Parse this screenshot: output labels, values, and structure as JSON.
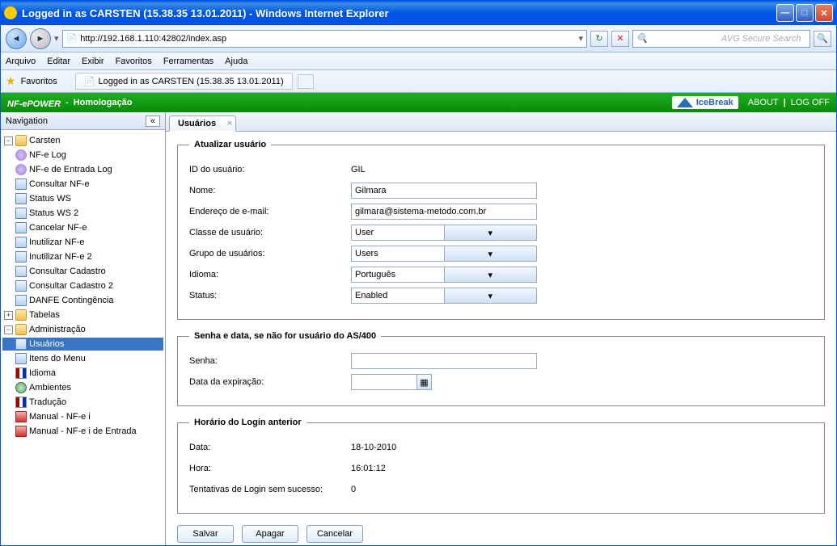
{
  "window": {
    "title": "Logged in as CARSTEN (15.38.35 13.01.2011) - Windows Internet Explorer"
  },
  "browser": {
    "url": "http://192.168.1.110:42802/index.asp",
    "search_placeholder": "AVG Secure Search",
    "menu": {
      "arquivo": "Arquivo",
      "editar": "Editar",
      "exibir": "Exibir",
      "favoritos": "Favoritos",
      "ferramentas": "Ferramentas",
      "ajuda": "Ajuda"
    },
    "fav_label": "Favoritos",
    "tab_title": "Logged in as CARSTEN (15.38.35 13.01.2011)"
  },
  "appbar": {
    "brand_left": "NF-e",
    "brand_right": "POWER",
    "env": "Homologação",
    "logo": "IceBreak",
    "about": "ABOUT",
    "logoff": "LOG OFF"
  },
  "sidebar": {
    "title": "Navigation",
    "items": {
      "carsten": "Carsten",
      "nfe_log": "NF-e Log",
      "nfe_entrada_log": "NF-e de Entrada Log",
      "consultar_nfe": "Consultar NF-e",
      "status_ws": "Status WS",
      "status_ws2": "Status WS 2",
      "cancelar_nfe": "Cancelar NF-e",
      "inutilizar_nfe": "Inutilizar NF-e",
      "inutilizar_nfe2": "Inutilizar NF-e 2",
      "consultar_cadastro": "Consultar Cadastro",
      "consultar_cadastro2": "Consultar Cadastro 2",
      "danfe_contingencia": "DANFE Contingência",
      "tabelas": "Tabelas",
      "administracao": "Administração",
      "usuarios": "Usuários",
      "itens_menu": "Itens do Menu",
      "idioma": "Idioma",
      "ambientes": "Ambientes",
      "traducao": "Tradução",
      "manual_nfe": "Manual - NF-e i",
      "manual_nfe_entrada": "Manual - NF-e i de Entrada"
    }
  },
  "tab": {
    "label": "Usuários"
  },
  "form": {
    "atualizar": {
      "legend": "Atualizar usuário",
      "id_label": "ID do usuário:",
      "id_value": "GIL",
      "nome_label": "Nome:",
      "nome_value": "Gilmara",
      "email_label": "Endereço de e-mail:",
      "email_value": "gilmara@sistema-metodo.com.br",
      "classe_label": "Classe de usuário:",
      "classe_value": "User",
      "grupo_label": "Grupo de usuários:",
      "grupo_value": "Users",
      "idioma_label": "Idioma:",
      "idioma_value": "Português",
      "status_label": "Status:",
      "status_value": "Enabled"
    },
    "senha": {
      "legend": "Senha e data, se não for usuário do AS/400",
      "senha_label": "Senha:",
      "data_exp_label": "Data da expiração:"
    },
    "login": {
      "legend": "Horário do Login anterior",
      "data_label": "Data:",
      "data_value": "18-10-2010",
      "hora_label": "Hora:",
      "hora_value": "16:01:12",
      "tentativas_label": "Tentativas de Login sem sucesso:",
      "tentativas_value": "0"
    },
    "buttons": {
      "salvar": "Salvar",
      "apagar": "Apagar",
      "cancelar": "Cancelar"
    }
  }
}
